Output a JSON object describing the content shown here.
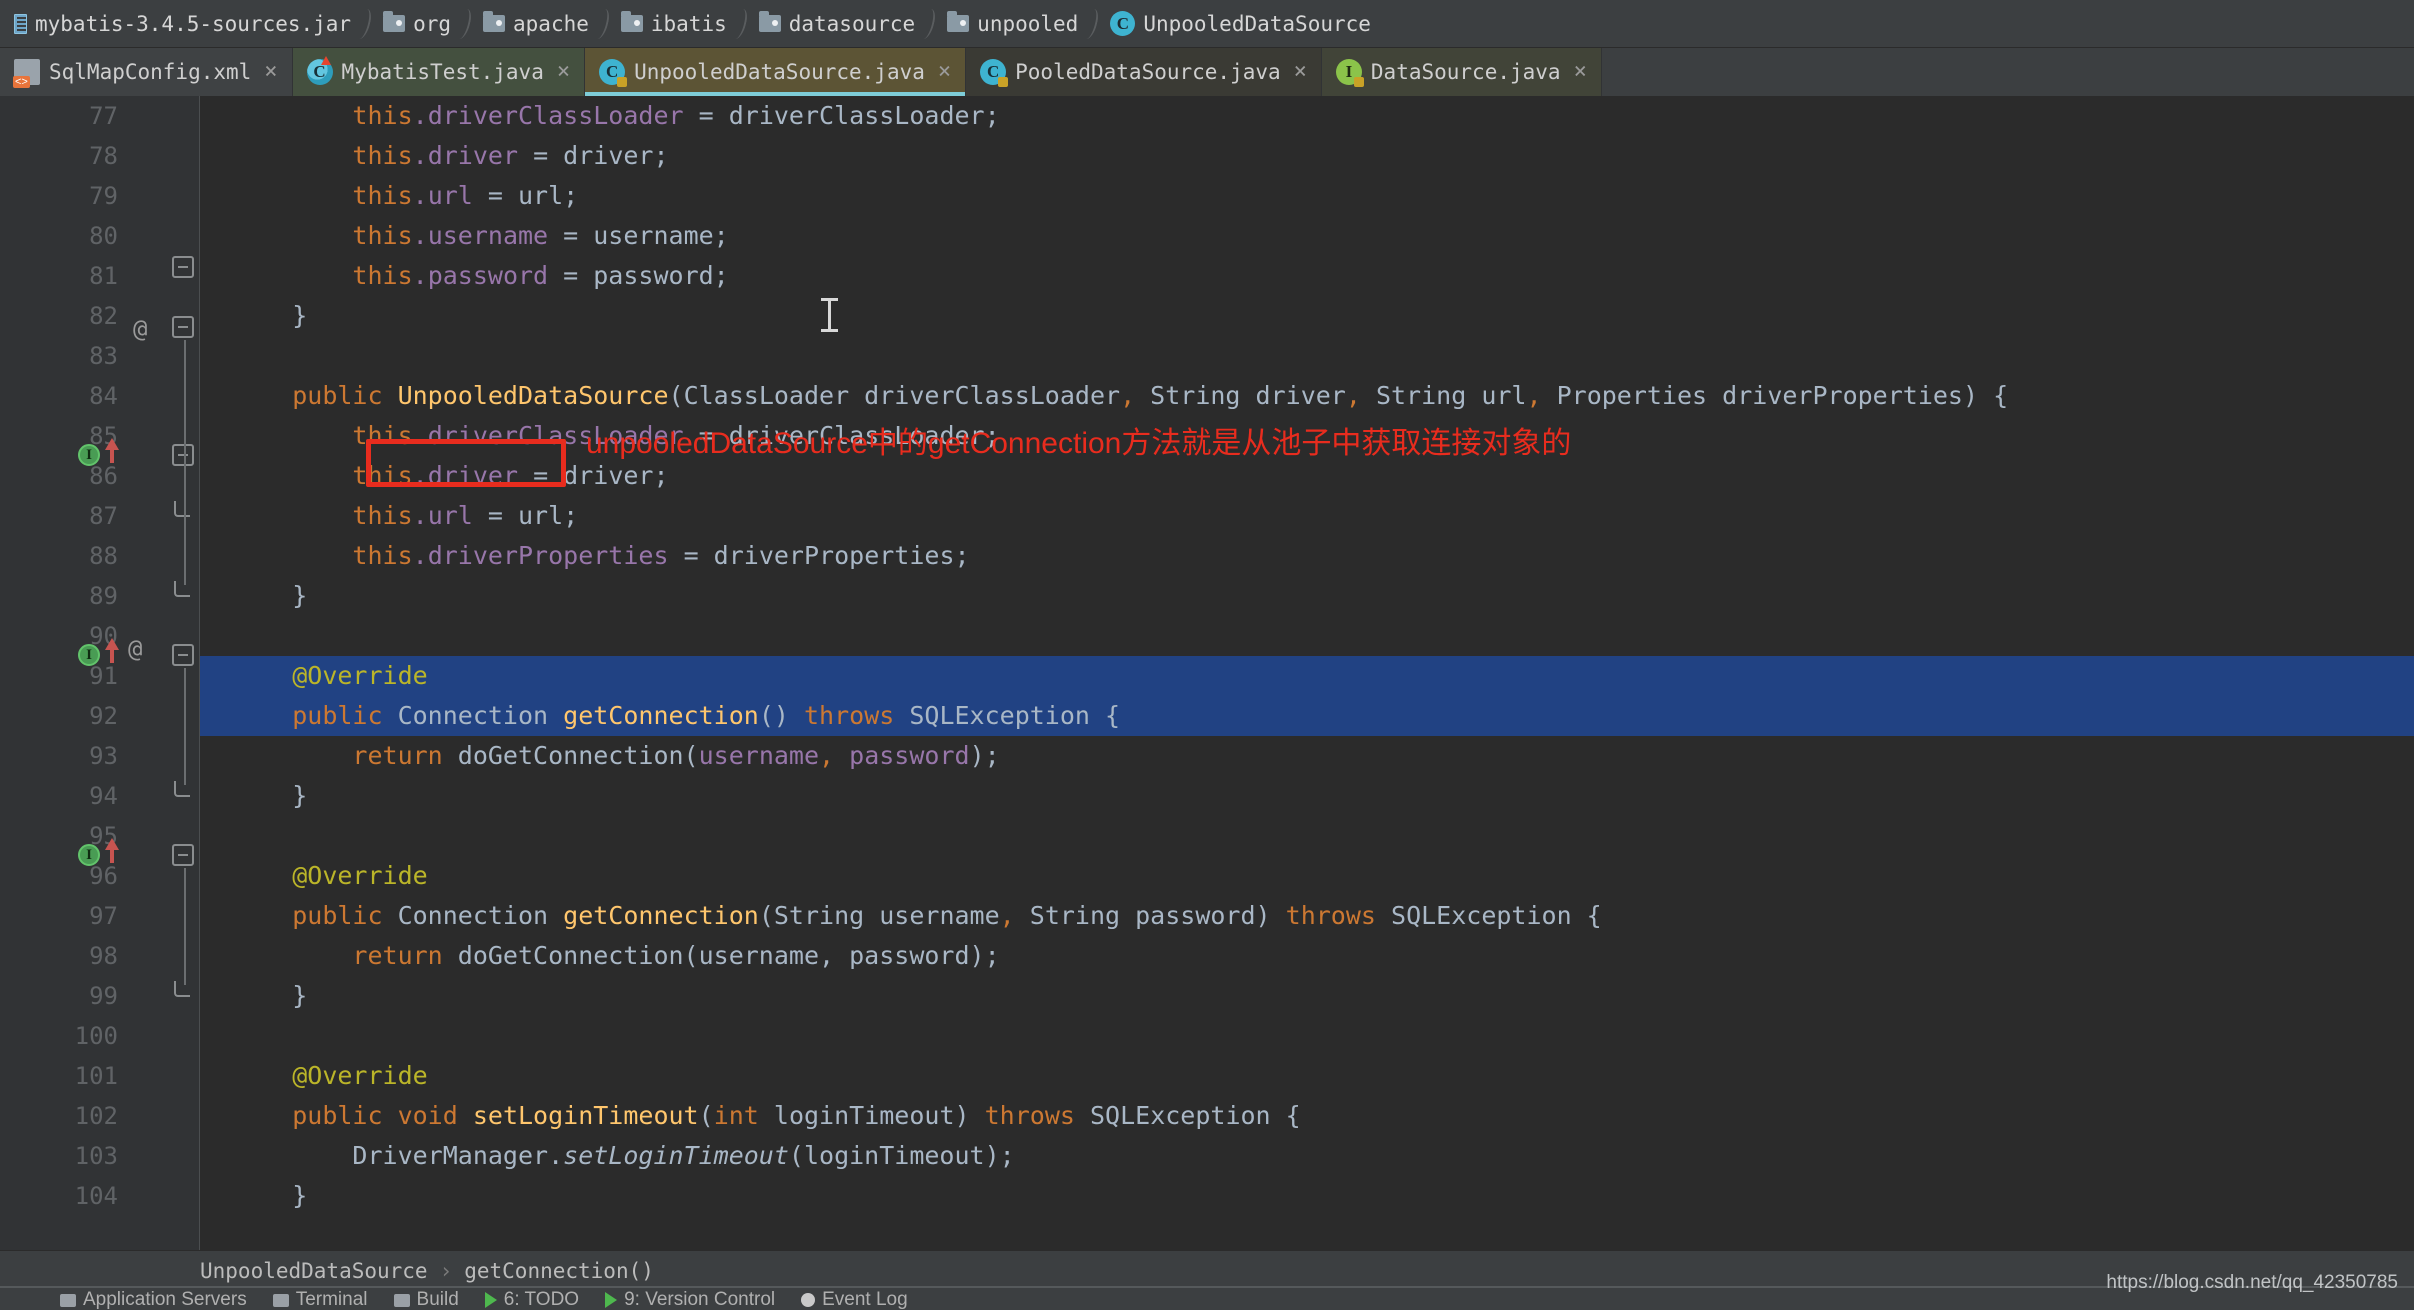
{
  "navigation": {
    "crumbs": [
      {
        "label": "mybatis-3.4.5-sources.jar",
        "icon": "jar-icon"
      },
      {
        "label": "org",
        "icon": "folder-icon"
      },
      {
        "label": "apache",
        "icon": "folder-icon"
      },
      {
        "label": "ibatis",
        "icon": "folder-icon"
      },
      {
        "label": "datasource",
        "icon": "folder-icon"
      },
      {
        "label": "unpooled",
        "icon": "folder-icon"
      },
      {
        "label": "UnpooledDataSource",
        "icon": "java-class-icon",
        "icon_letter": "C"
      }
    ]
  },
  "tabs": [
    {
      "label": "SqlMapConfig.xml",
      "icon": "xml-file-icon",
      "close": "×",
      "active": false
    },
    {
      "label": "MybatisTest.java",
      "icon": "java-class-icon",
      "icon_letter": "C",
      "close": "×",
      "active": false
    },
    {
      "label": "UnpooledDataSource.java",
      "icon": "java-class-icon",
      "icon_letter": "C",
      "close": "×",
      "active": true
    },
    {
      "label": "PooledDataSource.java",
      "icon": "java-class-icon",
      "icon_letter": "C",
      "close": "×",
      "active": false
    },
    {
      "label": "DataSource.java",
      "icon": "java-interface-icon",
      "icon_letter": "I",
      "close": "×",
      "active": false
    }
  ],
  "editor": {
    "lines": [
      {
        "num": "77",
        "indent": 4,
        "tokens": [
          {
            "t": "this",
            "c": "kw"
          },
          {
            "t": ".driverClassLoader ",
            "c": "fld"
          },
          {
            "t": "= driverClassLoader;",
            "c": "txt"
          }
        ]
      },
      {
        "num": "78",
        "indent": 4,
        "tokens": [
          {
            "t": "this",
            "c": "kw"
          },
          {
            "t": ".driver ",
            "c": "fld"
          },
          {
            "t": "= driver;",
            "c": "txt"
          }
        ]
      },
      {
        "num": "79",
        "indent": 4,
        "tokens": [
          {
            "t": "this",
            "c": "kw"
          },
          {
            "t": ".url ",
            "c": "fld"
          },
          {
            "t": "= url;",
            "c": "txt"
          }
        ]
      },
      {
        "num": "80",
        "indent": 4,
        "tokens": [
          {
            "t": "this",
            "c": "kw"
          },
          {
            "t": ".username ",
            "c": "fld"
          },
          {
            "t": "= username;",
            "c": "txt"
          }
        ]
      },
      {
        "num": "81",
        "indent": 4,
        "tokens": [
          {
            "t": "this",
            "c": "kw"
          },
          {
            "t": ".password ",
            "c": "fld"
          },
          {
            "t": "= password;",
            "c": "txt"
          }
        ]
      },
      {
        "num": "82",
        "indent": 2,
        "tokens": [
          {
            "t": "}",
            "c": "txt"
          }
        ]
      },
      {
        "num": "83",
        "indent": 0,
        "tokens": []
      },
      {
        "num": "84",
        "indent": 2,
        "tokens": [
          {
            "t": "public ",
            "c": "kw"
          },
          {
            "t": "UnpooledDataSource",
            "c": "cls"
          },
          {
            "t": "(ClassLoader driverClassLoader",
            "c": "txt"
          },
          {
            "t": ",",
            "c": "kw"
          },
          {
            "t": " String driver",
            "c": "txt"
          },
          {
            "t": ",",
            "c": "kw"
          },
          {
            "t": " String url",
            "c": "txt"
          },
          {
            "t": ",",
            "c": "kw"
          },
          {
            "t": " Properties driverProperties) {",
            "c": "txt"
          }
        ]
      },
      {
        "num": "85",
        "indent": 4,
        "tokens": [
          {
            "t": "this",
            "c": "kw"
          },
          {
            "t": ".driverClassLoader ",
            "c": "fld"
          },
          {
            "t": "= driverClassLoader;",
            "c": "txt"
          }
        ]
      },
      {
        "num": "86",
        "indent": 4,
        "tokens": [
          {
            "t": "this",
            "c": "kw"
          },
          {
            "t": ".driver ",
            "c": "fld"
          },
          {
            "t": "= driver;",
            "c": "txt"
          }
        ]
      },
      {
        "num": "87",
        "indent": 4,
        "tokens": [
          {
            "t": "this",
            "c": "kw"
          },
          {
            "t": ".url ",
            "c": "fld"
          },
          {
            "t": "= url;",
            "c": "txt"
          }
        ]
      },
      {
        "num": "88",
        "indent": 4,
        "tokens": [
          {
            "t": "this",
            "c": "kw"
          },
          {
            "t": ".driverProperties ",
            "c": "fld"
          },
          {
            "t": "= driverProperties;",
            "c": "txt"
          }
        ]
      },
      {
        "num": "89",
        "indent": 2,
        "tokens": [
          {
            "t": "}",
            "c": "txt"
          }
        ]
      },
      {
        "num": "90",
        "indent": 0,
        "tokens": []
      },
      {
        "num": "91",
        "indent": 2,
        "tokens": [
          {
            "t": "@Override",
            "c": "ann"
          }
        ]
      },
      {
        "num": "92",
        "indent": 2,
        "tokens": [
          {
            "t": "public ",
            "c": "kw"
          },
          {
            "t": "Connection ",
            "c": "txt"
          },
          {
            "t": "getConnection",
            "c": "cls"
          },
          {
            "t": "() ",
            "c": "txt"
          },
          {
            "t": "throws ",
            "c": "kw"
          },
          {
            "t": "SQLException {",
            "c": "txt"
          }
        ]
      },
      {
        "num": "93",
        "indent": 4,
        "tokens": [
          {
            "t": "return ",
            "c": "kw"
          },
          {
            "t": "doGetConnection(",
            "c": "txt"
          },
          {
            "t": "username",
            "c": "fld"
          },
          {
            "t": ",",
            "c": "kw"
          },
          {
            "t": " ",
            "c": "txt"
          },
          {
            "t": "password",
            "c": "fld"
          },
          {
            "t": ");",
            "c": "txt"
          }
        ]
      },
      {
        "num": "94",
        "indent": 2,
        "tokens": [
          {
            "t": "}",
            "c": "txt"
          }
        ]
      },
      {
        "num": "95",
        "indent": 0,
        "tokens": []
      },
      {
        "num": "96",
        "indent": 2,
        "tokens": [
          {
            "t": "@Override",
            "c": "ann"
          }
        ]
      },
      {
        "num": "97",
        "indent": 2,
        "tokens": [
          {
            "t": "public ",
            "c": "kw"
          },
          {
            "t": "Connection ",
            "c": "txt"
          },
          {
            "t": "getConnection",
            "c": "cls"
          },
          {
            "t": "(String username",
            "c": "txt"
          },
          {
            "t": ",",
            "c": "kw"
          },
          {
            "t": " String password) ",
            "c": "txt"
          },
          {
            "t": "throws ",
            "c": "kw"
          },
          {
            "t": "SQLException {",
            "c": "txt"
          }
        ]
      },
      {
        "num": "98",
        "indent": 4,
        "tokens": [
          {
            "t": "return ",
            "c": "kw"
          },
          {
            "t": "doGetConnection(username, password);",
            "c": "txt"
          }
        ]
      },
      {
        "num": "99",
        "indent": 2,
        "tokens": [
          {
            "t": "}",
            "c": "txt"
          }
        ]
      },
      {
        "num": "100",
        "indent": 0,
        "tokens": []
      },
      {
        "num": "101",
        "indent": 2,
        "tokens": [
          {
            "t": "@Override",
            "c": "ann"
          }
        ]
      },
      {
        "num": "102",
        "indent": 2,
        "tokens": [
          {
            "t": "public void ",
            "c": "kw"
          },
          {
            "t": "setLoginTimeout",
            "c": "cls"
          },
          {
            "t": "(",
            "c": "txt"
          },
          {
            "t": "int",
            "c": "kw"
          },
          {
            "t": " loginTimeout) ",
            "c": "txt"
          },
          {
            "t": "throws ",
            "c": "kw"
          },
          {
            "t": "SQLException {",
            "c": "txt"
          }
        ]
      },
      {
        "num": "103",
        "indent": 4,
        "tokens": [
          {
            "t": "DriverManager.",
            "c": "txt"
          },
          {
            "t": "setLoginTimeout",
            "c": "stat"
          },
          {
            "t": "(loginTimeout);",
            "c": "txt"
          }
        ]
      },
      {
        "num": "104",
        "indent": 2,
        "tokens": [
          {
            "t": "}",
            "c": "txt"
          }
        ]
      }
    ]
  },
  "annotation": {
    "note_text": "unpooledDataSource中的getConnection方法就是从池子中获取连接对象的",
    "note_color": "#e82c1e",
    "box_target": "getConnection()"
  },
  "bottom_breadcrumb": {
    "class": "UnpooledDataSource",
    "separator": "›",
    "method": "getConnection()"
  },
  "status_bar": {
    "items": [
      "Application Servers",
      "Terminal",
      "Build",
      "6: TODO",
      "9: Version Control",
      "Event Log"
    ]
  },
  "watermark": {
    "text": "https://blog.csdn.net/qq_42350785"
  },
  "colors": {
    "editor_bg": "#2b2b2b",
    "gutter_bg": "#313335",
    "chrome_bg": "#3c3f41",
    "selection": "#214283",
    "active_tab": "#5c5435",
    "accent": "#7ecdd8",
    "keyword": "#cc7832",
    "class_name": "#ffc66d",
    "field": "#9876aa",
    "annotation": "#bbb529",
    "plain_text": "#a9b7c6",
    "line_number": "#606366"
  }
}
